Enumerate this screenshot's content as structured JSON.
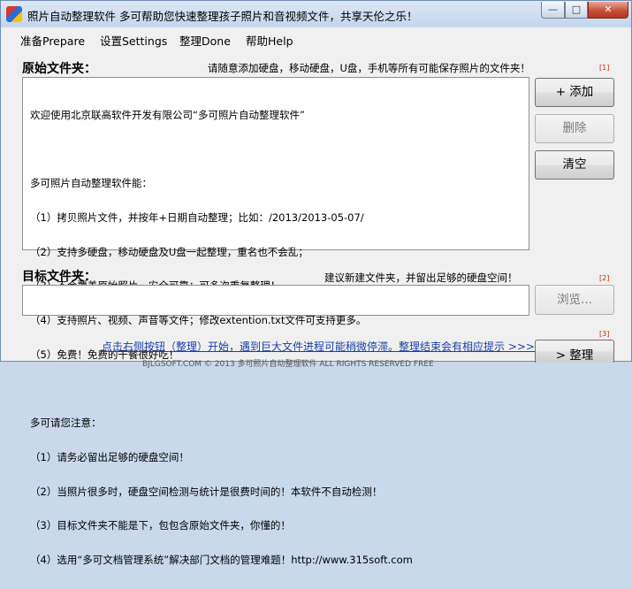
{
  "window": {
    "title": "照片自动整理软件 多可帮助您快速整理孩子照片和音视频文件，共享天伦之乐！",
    "controls": {
      "minimize": "—",
      "maximize": "□",
      "close": "✕"
    }
  },
  "menu": [
    "准备Prepare",
    "设置Settings",
    "整理Done",
    "帮助Help"
  ],
  "source": {
    "label": "原始文件夹：",
    "hint": "请随意添加硬盘，移动硬盘，U盘，手机等所有可能保存照片的文件夹！",
    "index": "[1]",
    "lines": [
      "欢迎使用北京联高软件开发有限公司“多可照片自动整理软件”",
      "",
      "多可照片自动整理软件能：",
      "（1）拷贝照片文件，并按年+日期自动整理；比如：/2013/2013-05-07/",
      "（2）支持多硬盘，移动硬盘及U盘一起整理，重名也不会乱；",
      "（3）不会覆盖原始照片，安全可靠；可多次重复整理！",
      "（4）支持照片、视频、声音等文件；修改extention.txt文件可支持更多。",
      "（5）免费！免费的干餐很好吃！",
      "",
      "多可请您注意：",
      "（1）请务必留出足够的硬盘空间！",
      "（2）当照片很多时，硬盘空间检测与统计是很费时间的！本软件不自动检测！",
      "（3）目标文件夹不能是下，包包含原始文件夹，你懂的！",
      "（4）选用“多可文档管理系统”解决部门文档的管理难题！http://www.315soft.com"
    ],
    "buttons": {
      "add": "+ 添加",
      "delete": "删除",
      "clear": "清空"
    }
  },
  "target": {
    "label": "目标文件夹：",
    "hint": "建议新建文件夹，并留出足够的硬盘空间！",
    "index": "[2]",
    "value": "",
    "browse": "浏览..."
  },
  "footer": {
    "link": "点击右侧按钮（整理）开始，遇到巨大文件进程可能稍微停滞。整理结束会有相应提示 >>>",
    "index": "[3]",
    "organize": "> 整理",
    "status": "BJLGSOFT.COM © 2013 多可照片自动整理软件 ALL RIGHTS RESERVED  FREE"
  }
}
